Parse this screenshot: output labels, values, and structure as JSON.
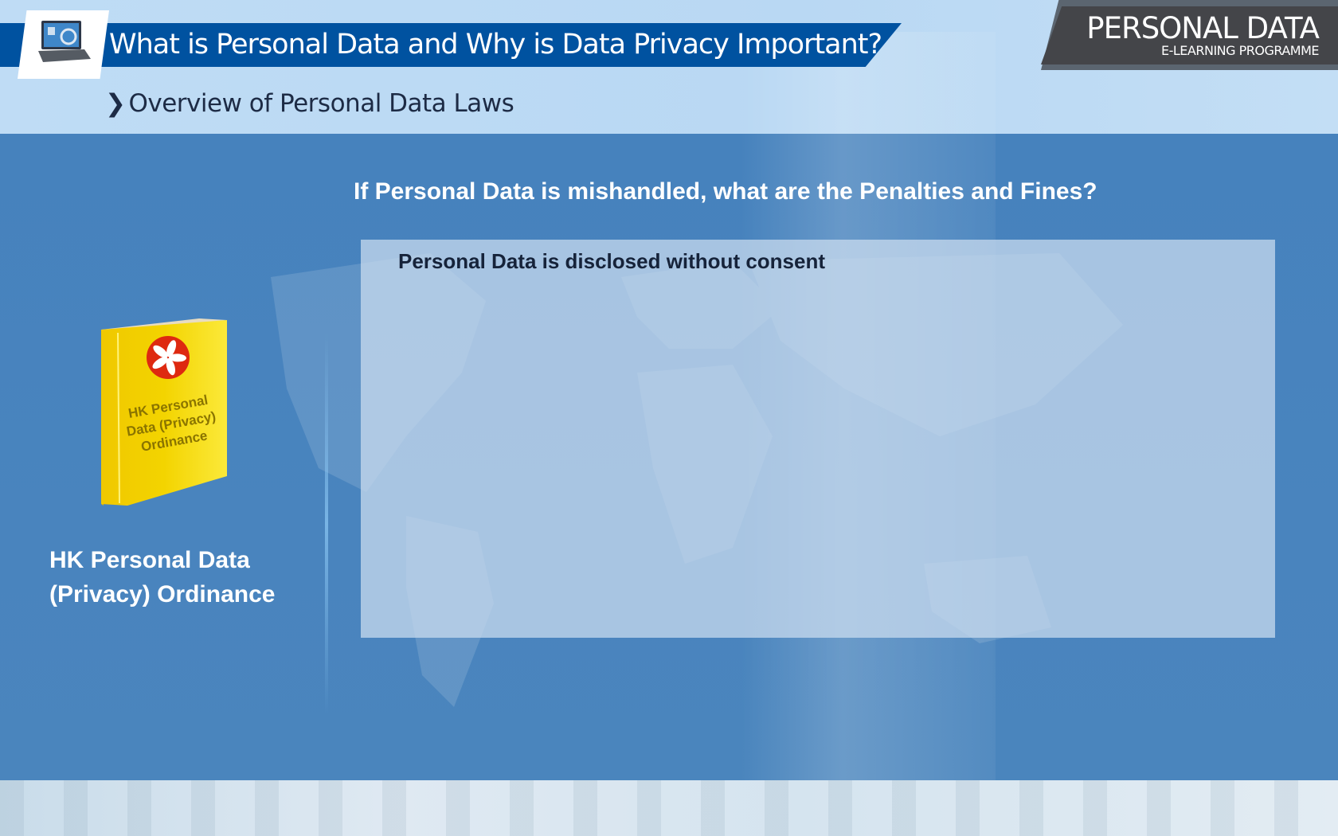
{
  "header": {
    "title": "What is Personal Data and Why is Data Privacy Important?",
    "subtitle": "Overview of Personal Data Laws",
    "subtitle_chevron": "❯",
    "brand": {
      "line1": "PERSONAL DATA",
      "line2": "E-LEARNING PROGRAMME"
    }
  },
  "main": {
    "question": "If Personal Data is mishandled, what are the Penalties and Fines?",
    "panel_heading": "Personal Data is disclosed without consent",
    "book": {
      "cover_text": "HK Personal Data (Privacy) Ordinance"
    },
    "law_label_line1": "HK Personal Data",
    "law_label_line2": "(Privacy) Ordinance"
  },
  "colors": {
    "title_bar": "#0052a0",
    "main_band": "#4682bd",
    "brand_box": "#444549",
    "book": "#f5d800",
    "flag": "#de2910"
  }
}
